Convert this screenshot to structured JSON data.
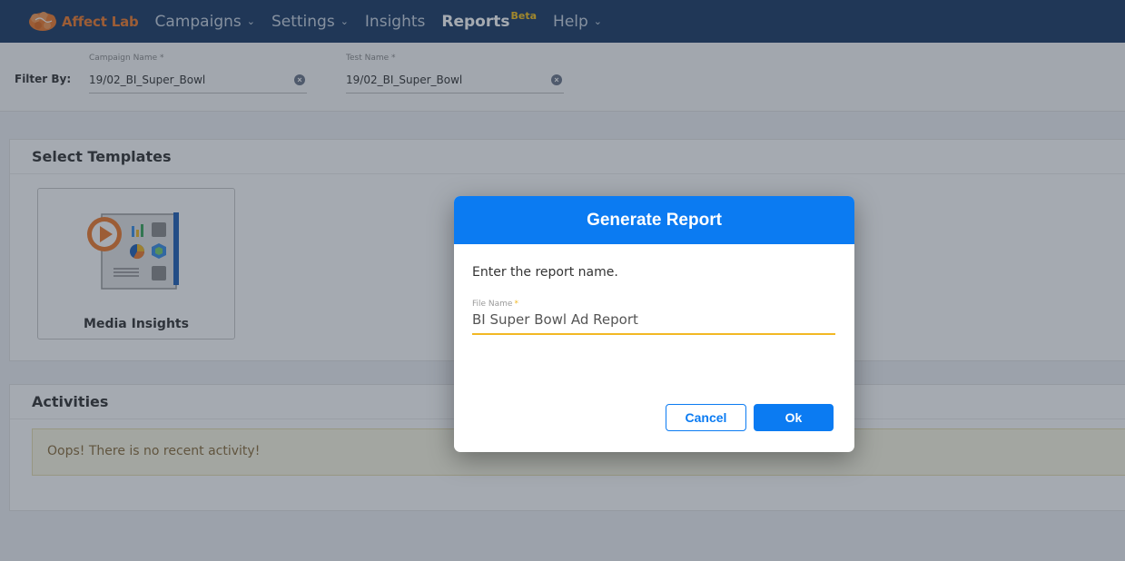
{
  "nav": {
    "logo_text": "Affect Lab",
    "items": [
      {
        "label": "Campaigns",
        "has_dropdown": true
      },
      {
        "label": "Settings",
        "has_dropdown": true
      },
      {
        "label": "Insights",
        "has_dropdown": false
      },
      {
        "label": "Reports",
        "badge": "Beta",
        "active": true
      },
      {
        "label": "Help",
        "has_dropdown": true
      }
    ]
  },
  "filters": {
    "label": "Filter By:",
    "campaign": {
      "label": "Campaign Name *",
      "value": "19/02_BI_Super_Bowl"
    },
    "test": {
      "label": "Test Name *",
      "value": "19/02_BI_Super_Bowl"
    }
  },
  "templates": {
    "title": "Select Templates",
    "items": [
      {
        "label": "Media Insights",
        "icon": "media-insights-icon"
      }
    ]
  },
  "activities": {
    "title": "Activities",
    "empty_message": "Oops! There is no recent activity!"
  },
  "modal": {
    "title": "Generate Report",
    "prompt": "Enter the report name.",
    "field_label": "File Name",
    "field_required_marker": "*",
    "field_value": "BI Super Bowl Ad Report",
    "cancel_label": "Cancel",
    "ok_label": "Ok"
  },
  "colors": {
    "navbar": "#1a3a64",
    "brand": "#f07a2b",
    "beta_badge": "#f7c31c",
    "primary": "#0b7bf2",
    "field_focus": "#f2b824"
  }
}
